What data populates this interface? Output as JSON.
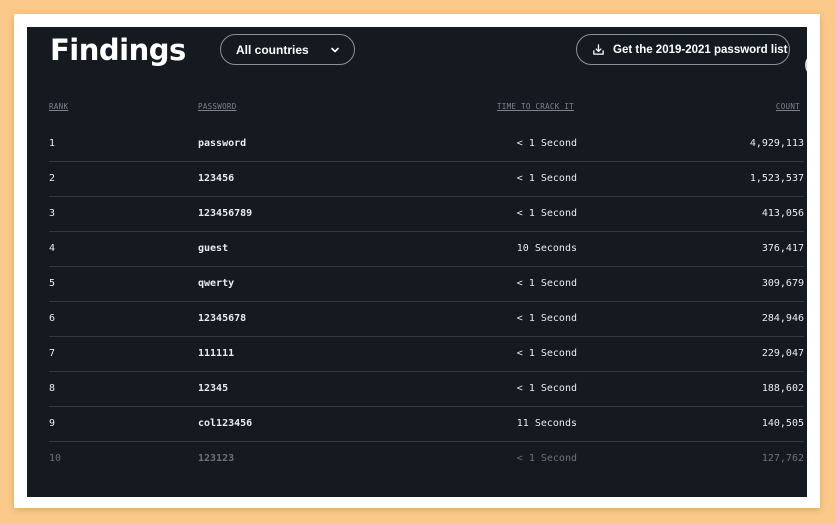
{
  "header": {
    "title": "Findings",
    "country_select": "All countries",
    "download_label": "Get the 2019-2021 password list"
  },
  "table": {
    "columns": [
      "RANK",
      "PASSWORD",
      "TIME TO CRACK IT",
      "COUNT"
    ],
    "rows": [
      {
        "rank": "1",
        "password": "password",
        "time": "< 1 Second",
        "count": "4,929,113"
      },
      {
        "rank": "2",
        "password": "123456",
        "time": "< 1 Second",
        "count": "1,523,537"
      },
      {
        "rank": "3",
        "password": "123456789",
        "time": "< 1 Second",
        "count": "413,056"
      },
      {
        "rank": "4",
        "password": "guest",
        "time": "10 Seconds",
        "count": "376,417"
      },
      {
        "rank": "5",
        "password": "qwerty",
        "time": "< 1 Second",
        "count": "309,679"
      },
      {
        "rank": "6",
        "password": "12345678",
        "time": "< 1 Second",
        "count": "284,946"
      },
      {
        "rank": "7",
        "password": "111111",
        "time": "< 1 Second",
        "count": "229,047"
      },
      {
        "rank": "8",
        "password": "12345",
        "time": "< 1 Second",
        "count": "188,602"
      },
      {
        "rank": "9",
        "password": "col123456",
        "time": "11 Seconds",
        "count": "140,505"
      },
      {
        "rank": "10",
        "password": "123123",
        "time": "< 1 Second",
        "count": "127,762"
      }
    ]
  },
  "icons": {
    "select": "chevron-down-icon",
    "download": "download-icon"
  },
  "colors": {
    "background": "#fbc98a",
    "panel": "#151a21",
    "text": "#e9ebee",
    "muted": "#7c828b",
    "divider": "#343a43"
  }
}
